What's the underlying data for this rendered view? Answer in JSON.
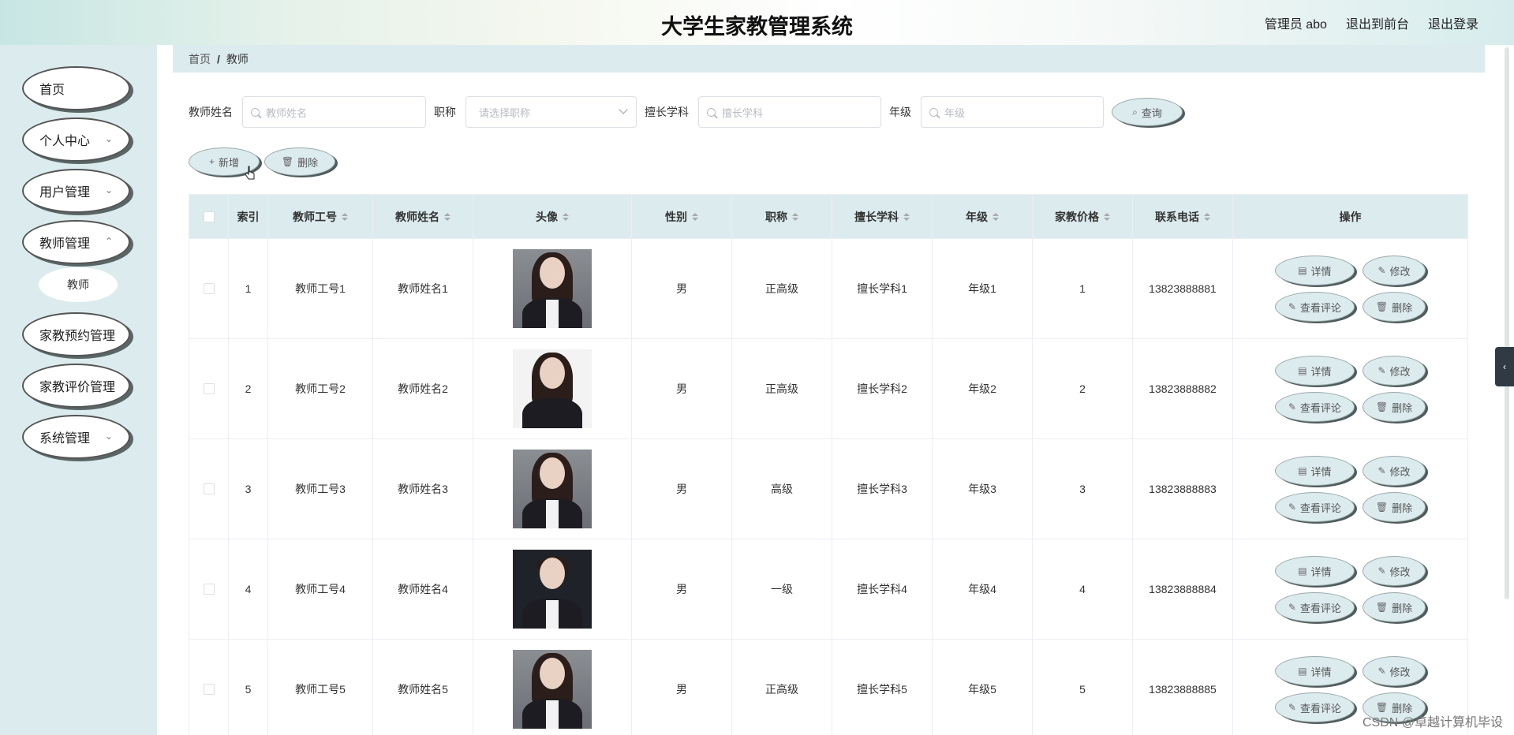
{
  "header": {
    "title": "大学生家教管理系统",
    "admin_label": "管理员 abo",
    "front_link": "退出到前台",
    "logout_link": "退出登录"
  },
  "sidebar": {
    "items": [
      {
        "label": "首页",
        "has_children": false
      },
      {
        "label": "个人中心",
        "has_children": true
      },
      {
        "label": "用户管理",
        "has_children": true
      },
      {
        "label": "教师管理",
        "has_children": true
      },
      {
        "label": "家教预约管理",
        "has_children": false
      },
      {
        "label": "家教评价管理",
        "has_children": false
      },
      {
        "label": "系统管理",
        "has_children": true
      }
    ],
    "submenu_teacher": "教师"
  },
  "breadcrumb": {
    "home": "首页",
    "separator": "/",
    "current": "教师"
  },
  "search": {
    "name_label": "教师姓名",
    "name_placeholder": "教师姓名",
    "title_label": "职称",
    "title_placeholder": "请选择职称",
    "subject_label": "擅长学科",
    "subject_placeholder": "擅长学科",
    "grade_label": "年级",
    "grade_placeholder": "年级",
    "query_button": "查询"
  },
  "actions": {
    "add_button": "新增",
    "delete_button": "删除"
  },
  "table": {
    "columns": [
      "索引",
      "教师工号",
      "教师姓名",
      "头像",
      "性别",
      "职称",
      "擅长学科",
      "年级",
      "家教价格",
      "联系电话",
      "操作"
    ],
    "rows": [
      {
        "index": "1",
        "id": "教师工号1",
        "name": "教师姓名1",
        "gender": "男",
        "title": "正高级",
        "subject": "擅长学科1",
        "grade": "年级1",
        "price": "1",
        "phone": "13823888881"
      },
      {
        "index": "2",
        "id": "教师工号2",
        "name": "教师姓名2",
        "gender": "男",
        "title": "正高级",
        "subject": "擅长学科2",
        "grade": "年级2",
        "price": "2",
        "phone": "13823888882"
      },
      {
        "index": "3",
        "id": "教师工号3",
        "name": "教师姓名3",
        "gender": "男",
        "title": "高级",
        "subject": "擅长学科3",
        "grade": "年级3",
        "price": "3",
        "phone": "13823888883"
      },
      {
        "index": "4",
        "id": "教师工号4",
        "name": "教师姓名4",
        "gender": "男",
        "title": "一级",
        "subject": "擅长学科4",
        "grade": "年级4",
        "price": "4",
        "phone": "13823888884"
      },
      {
        "index": "5",
        "id": "教师工号5",
        "name": "教师姓名5",
        "gender": "男",
        "title": "正高级",
        "subject": "擅长学科5",
        "grade": "年级5",
        "price": "5",
        "phone": "13823888885"
      }
    ],
    "op_labels": {
      "detail": "详情",
      "edit": "修改",
      "comments": "查看评论",
      "delete": "删除"
    }
  },
  "watermark": "CSDN @卓越计算机毕设"
}
